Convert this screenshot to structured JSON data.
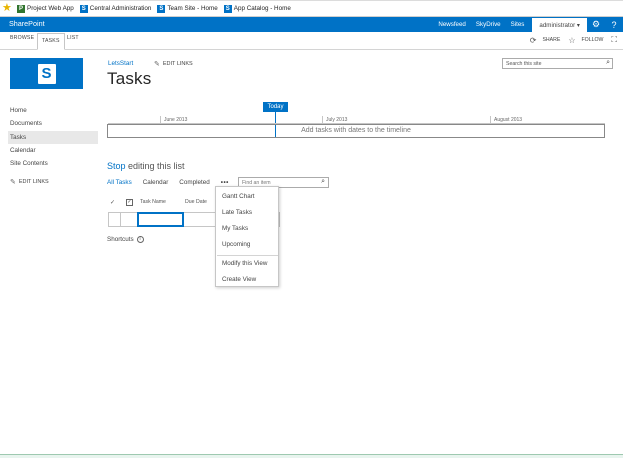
{
  "favorites": [
    {
      "label": "Project Web App",
      "icon": "project-icon"
    },
    {
      "label": "Central Administration",
      "icon": "sharepoint-icon"
    },
    {
      "label": "Team Site - Home",
      "icon": "sharepoint-icon"
    },
    {
      "label": "App Catalog - Home",
      "icon": "sharepoint-icon"
    }
  ],
  "suitebar": {
    "brand": "SharePoint",
    "links": [
      "Newsfeed",
      "SkyDrive",
      "Sites"
    ],
    "user": "administrator ▾",
    "settings_icon": "⚙",
    "help_icon": "?",
    "color": "#0072c6"
  },
  "ribbon": {
    "tabs": [
      "BROWSE",
      "TASKS",
      "LIST"
    ],
    "share": "SHARE",
    "follow": "FOLLOW"
  },
  "header": {
    "breadcrumb": "LetsStart",
    "edit_links": "EDIT LINKS",
    "title": "Tasks",
    "search_placeholder": "Search this site"
  },
  "leftnav": {
    "items": [
      "Home",
      "Documents",
      "Tasks",
      "Calendar",
      "Site Contents"
    ],
    "edit_links": "EDIT LINKS"
  },
  "timeline": {
    "today_label": "Today",
    "months": [
      "June 2013",
      "July 2013",
      "August 2013"
    ],
    "placeholder": "Add tasks with dates to the timeline"
  },
  "list": {
    "stop_word": "Stop",
    "stop_rest": " editing this list",
    "views": [
      "All Tasks",
      "Calendar",
      "Completed"
    ],
    "more": "•••",
    "find_placeholder": "Find an item",
    "columns": [
      "Task Name",
      "Due Date"
    ],
    "shortcuts": "Shortcuts"
  },
  "view_menu": {
    "items": [
      "Gantt Chart",
      "Late Tasks",
      "My Tasks",
      "Upcoming"
    ],
    "actions": [
      "Modify this View",
      "Create View"
    ]
  }
}
